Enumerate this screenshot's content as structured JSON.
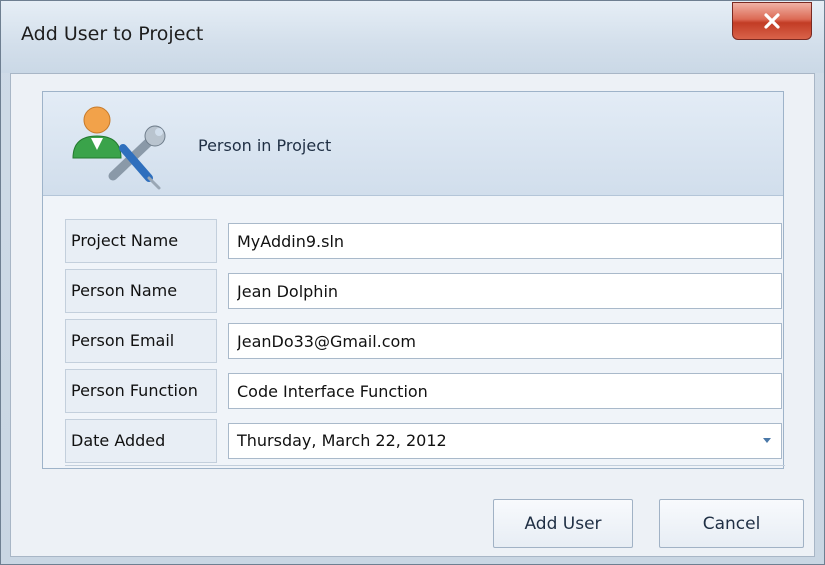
{
  "window": {
    "title": "Add User to Project",
    "close_icon": "close-icon"
  },
  "group": {
    "caption": "Person in Project",
    "icon": "user-tools-icon"
  },
  "form": {
    "rows": [
      {
        "label": "Project Name",
        "value": "MyAddin9.sln"
      },
      {
        "label": "Person Name",
        "value": "Jean Dolphin"
      },
      {
        "label": "Person Email",
        "value": "JeanDo33@Gmail.com"
      },
      {
        "label": "Person Function",
        "value": "Code Interface Function"
      },
      {
        "label": "Date Added",
        "value": "Thursday, March 22, 2012"
      }
    ]
  },
  "buttons": {
    "add_user": "Add User",
    "cancel": "Cancel"
  },
  "colors": {
    "accent": "#4a78a8",
    "close_red": "#c23c25"
  }
}
